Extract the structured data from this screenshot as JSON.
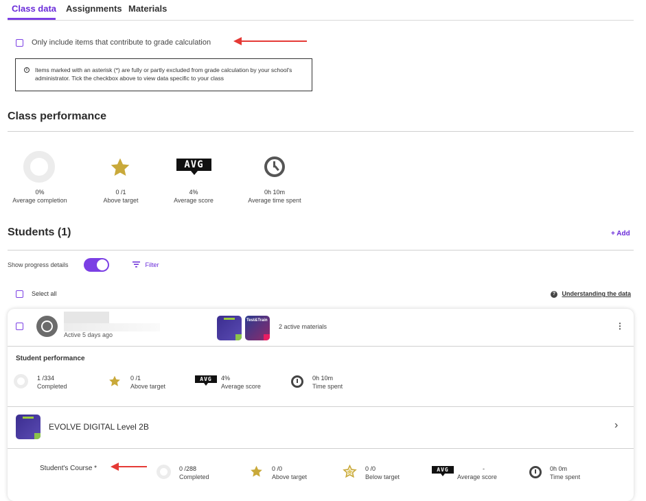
{
  "tabs": [
    "Class data",
    "Assignments",
    "Materials"
  ],
  "grade_filter": {
    "label": "Only include items that contribute to grade calculation",
    "info": "Items marked with an asterisk (*) are fully or partly excluded from grade calculation by your school's administrator. Tick the checkbox above to view data specific to your class"
  },
  "class_performance": {
    "title": "Class performance",
    "metrics": [
      {
        "value": "0%",
        "label": "Average completion",
        "icon": "completion-ring-icon"
      },
      {
        "value": "0 /1",
        "label": "Above target",
        "icon": "star-icon"
      },
      {
        "value": "4%",
        "label": "Average score",
        "icon": "avg-icon"
      },
      {
        "value": "0h 10m",
        "label": "Average time spent",
        "icon": "clock-icon"
      }
    ]
  },
  "students": {
    "title": "Students (1)",
    "add_label": "Add",
    "show_progress_label": "Show progress details",
    "filter_label": "Filter",
    "select_all_label": "Select all",
    "understanding_label": "Understanding the data"
  },
  "avg_text": "AVG",
  "student_card": {
    "active_text": "Active 5 days ago",
    "materials_text": "2 active materials",
    "performance_title": "Student performance",
    "metrics": [
      {
        "value": "1 /334",
        "label": "Completed"
      },
      {
        "value": "0 /1",
        "label": "Above target"
      },
      {
        "value": "4%",
        "label": "Average score"
      },
      {
        "value": "0h 10m",
        "label": "Time spent"
      }
    ],
    "thumb2_text": "Test&Train",
    "course_name": "EVOLVE DIGITAL Level 2B",
    "course_row": {
      "label": "Student's Course *",
      "metrics": [
        {
          "value": "0 /288",
          "label": "Completed"
        },
        {
          "value": "0 /0",
          "label": "Above target"
        },
        {
          "value": "0 /0",
          "label": "Below target"
        },
        {
          "value": "-",
          "label": "Average score"
        },
        {
          "value": "0h 0m",
          "label": "Time spent"
        }
      ]
    }
  },
  "colors": {
    "accent": "#7b3fe4",
    "star": "#c9a93a",
    "arrow": "#e53935"
  }
}
